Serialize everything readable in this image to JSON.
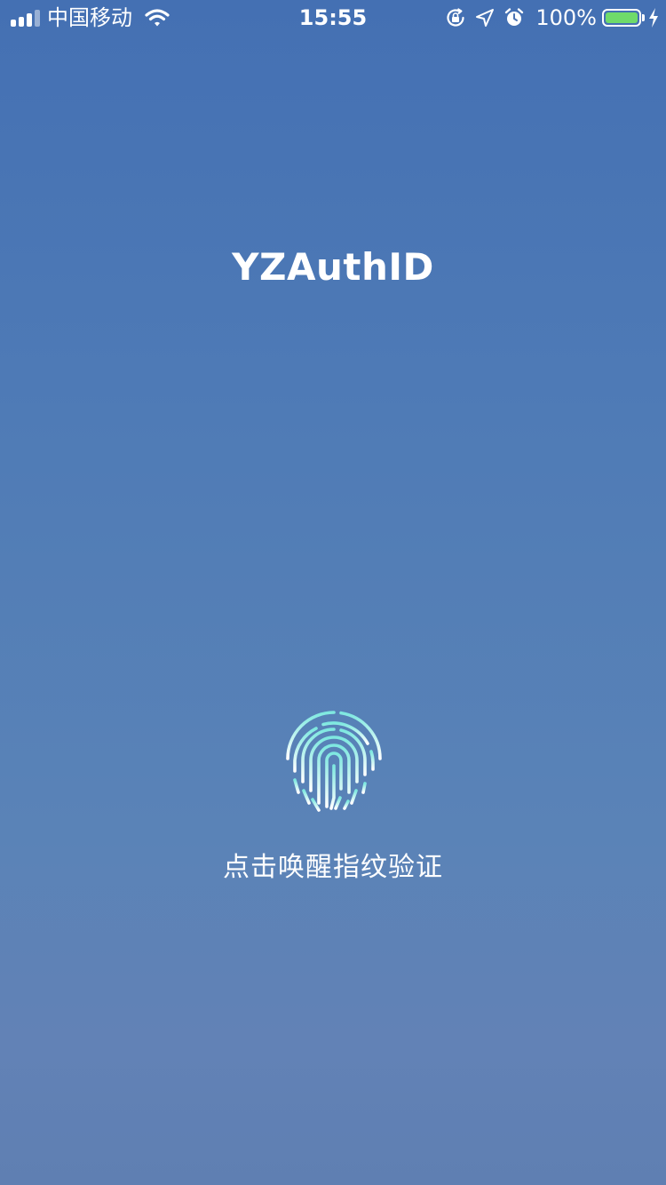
{
  "status_bar": {
    "carrier": "中国移动",
    "time": "15:55",
    "battery_percent": "100%",
    "signal_bars": 4,
    "signal_active": 3,
    "icons": [
      "wifi-icon",
      "orientation-lock-icon",
      "location-icon",
      "alarm-icon",
      "battery-icon",
      "charging-bolt-icon"
    ]
  },
  "app": {
    "title": "YZAuthID",
    "hint": "点击唤醒指纹验证",
    "fingerprint_icon": "fingerprint-icon"
  },
  "colors": {
    "background_top": "#4470b3",
    "background_bottom": "#5f7fb2",
    "fingerprint_top": "#7ee8e0",
    "fingerprint_bottom": "#ffffff",
    "battery_fill": "#6fdb6a"
  }
}
